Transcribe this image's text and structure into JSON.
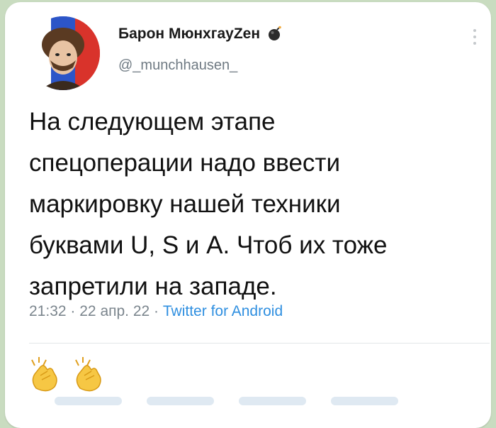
{
  "profile": {
    "display_name": "Барон МюнхгауZен",
    "handle": "@_munchhausen_"
  },
  "tweet": {
    "lines": [
      "На следующем этапе",
      "спецоперации надо ввести",
      "маркировку нашей техники",
      "буквами U, S и A. Чтоб их тоже",
      "запретили на западе."
    ],
    "time": "21:32",
    "separator": "·",
    "date": "22 апр. 22",
    "source": "Twitter for Android"
  },
  "reactions": {
    "emoji": "👏👏"
  },
  "colors": {
    "source_link": "#2f8fe0",
    "meta_text": "#7b858d",
    "card_bg": "#ffffff",
    "page_bg": "#c9dcc0"
  },
  "icons": [
    "avatar",
    "bomb-icon",
    "more-options-icon",
    "clapping-hands-icon"
  ]
}
